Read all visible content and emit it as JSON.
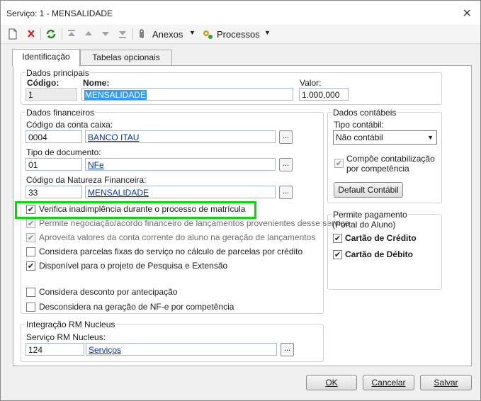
{
  "window": {
    "title": "Serviço: 1 - MENSALIDADE"
  },
  "toolbar": {
    "anexos_label": "Anexos",
    "processos_label": "Processos"
  },
  "tabs": [
    {
      "label": "Identificação"
    },
    {
      "label": "Tabelas opcionais"
    }
  ],
  "dados_principais": {
    "legend": "Dados principais",
    "codigo_label": "Código:",
    "codigo_value": "1",
    "nome_label": "Nome:",
    "nome_value": "MENSALIDADE",
    "valor_label": "Valor:",
    "valor_value": "1.000,000"
  },
  "dados_financeiros": {
    "legend": "Dados financeiros",
    "conta_caixa_label": "Código da conta caixa:",
    "conta_caixa_code": "0004",
    "conta_caixa_name": "BANCO ITAU",
    "tipo_doc_label": "Tipo de documento:",
    "tipo_doc_code": "01",
    "tipo_doc_name": "NFe",
    "natureza_label": "Código da Natureza Financeira:",
    "natureza_code": "33",
    "natureza_name": "MENSALIDADE",
    "lookup_button": "...",
    "checkboxes": [
      {
        "label": "Verifica inadimplência durante o processo de matrícula",
        "checked": true,
        "disabled": false
      },
      {
        "label": "Permite negociação/acordo financeiro de lançamentos provenientes desse serviço",
        "checked": true,
        "disabled": true
      },
      {
        "label": "Aproveita valores da conta corrente do aluno na geração de lançamentos",
        "checked": true,
        "disabled": true
      },
      {
        "label": "Considera parcelas fixas do serviço no cálculo de parcelas por crédito",
        "checked": false,
        "disabled": false
      },
      {
        "label": "Disponível para o projeto de Pesquisa e Extensão",
        "checked": true,
        "disabled": false
      },
      {
        "label": "Considera desconto por antecipação",
        "checked": false,
        "disabled": false
      },
      {
        "label": "Desconsidera na geração de NF-e por competência",
        "checked": false,
        "disabled": false
      }
    ]
  },
  "dados_contabeis": {
    "legend": "Dados contábeis",
    "tipo_label": "Tipo contábil:",
    "tipo_value": "Não contábil",
    "compoe_label_1": "Compõe contabilização",
    "compoe_label_2": "por competência",
    "compoe_checked": true,
    "default_button": "Default Contábil"
  },
  "permite_pagamento": {
    "legend": "Permite pagamento",
    "sub": "(Portal do Aluno)",
    "credito_label": "Cartão de Crédito",
    "credito_checked": true,
    "debito_label": "Cartão de Débito",
    "debito_checked": true
  },
  "integracao": {
    "legend": "Integração RM Nucleus",
    "servico_label": "Serviço RM Nucleus:",
    "servico_code": "124",
    "servico_name": "Serviços"
  },
  "footer": {
    "ok": "OK",
    "cancelar": "Cancelar",
    "salvar": "Salvar"
  },
  "colors": {
    "highlight": "#00dd00",
    "link": "#0033aa",
    "selection": "#3399ff"
  }
}
